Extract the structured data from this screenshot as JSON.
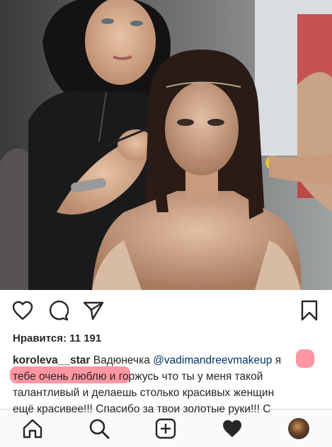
{
  "post": {
    "likes_text": "Нравится: 11 191",
    "caption": {
      "username": "koroleva__star",
      "text_before_mention": " Вадюнечка ",
      "mention": "@vadimandreevmakeup",
      "text_line1_end": " я",
      "highlighted": "тебе очень люблю",
      "text_line2_end": " и горжусь что ты у меня такой",
      "line3": "талантливый и делаешь столько красивых женщин",
      "line4": "ещё красивее!!! Спасибо за твои золотые руки!!! С"
    }
  },
  "colors": {
    "text": "#262626",
    "mention": "#003569",
    "highlight": "#ff2d46",
    "tabbar_bg": "#fafafa"
  },
  "icons": {
    "actions": [
      "heart-outline",
      "comment-bubble",
      "share-paper-plane",
      "bookmark"
    ],
    "tabs": [
      "home",
      "search",
      "new-post-plus",
      "activity-heart-filled",
      "profile-avatar"
    ]
  }
}
